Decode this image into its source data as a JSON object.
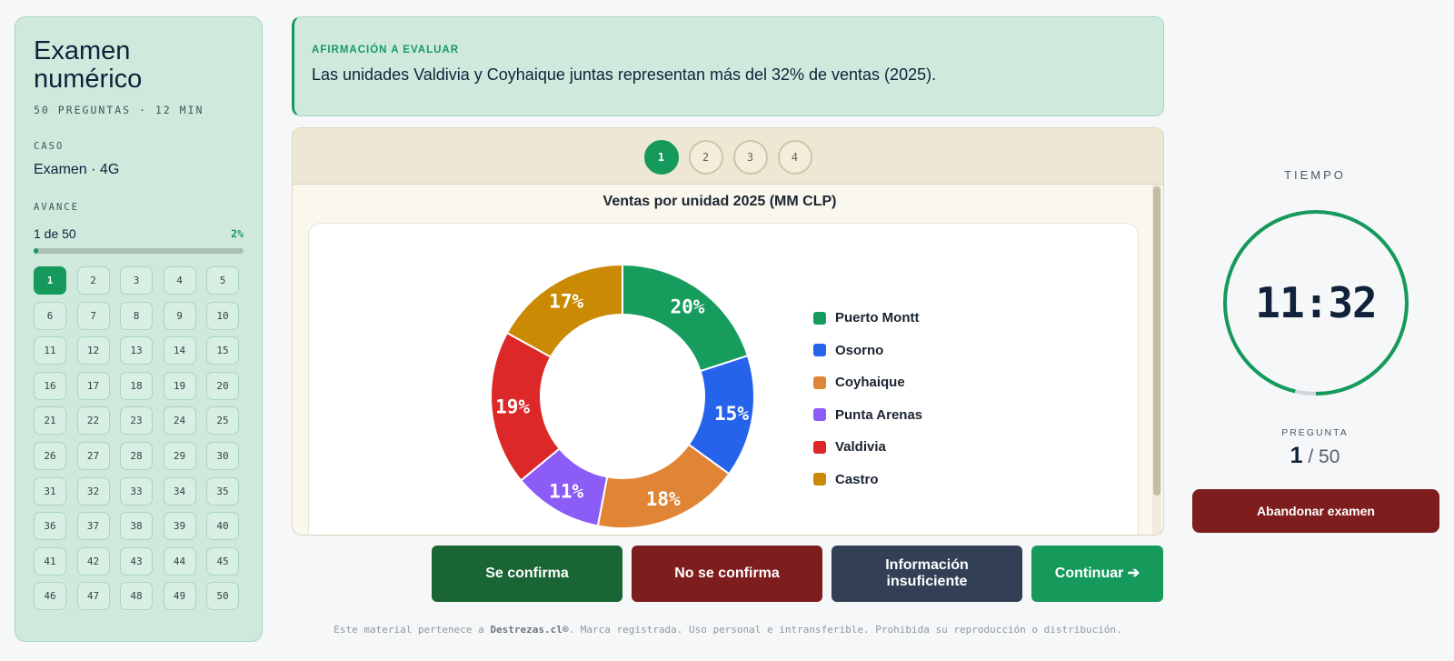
{
  "sidebar": {
    "title_line1": "Examen",
    "title_line2": "numérico",
    "meta": "50 PREGUNTAS · 12 MIN",
    "caso_label": "CASO",
    "caso_value": "Examen · 4G",
    "avance_label": "AVANCE",
    "progress_text": "1 de 50",
    "progress_pct_label": "2%",
    "progress_fraction": 0.02,
    "current_question": 1,
    "question_count": 50
  },
  "statement": {
    "label": "AFIRMACIÓN A EVALUAR",
    "text": "Las unidades Valdivia y Coyhaique juntas representan más del 32% de ventas (2025)."
  },
  "panel": {
    "tabs": [
      "1",
      "2",
      "3",
      "4"
    ],
    "active_tab": 0
  },
  "chart_data": {
    "type": "pie",
    "title": "Ventas por unidad 2025 (MM CLP)",
    "donut": true,
    "legend_position": "right",
    "categories": [
      "Puerto Montt",
      "Osorno",
      "Coyhaique",
      "Punta Arenas",
      "Valdivia",
      "Castro"
    ],
    "values": [
      20,
      15,
      18,
      11,
      19,
      17
    ],
    "labels": [
      "20%",
      "15%",
      "18%",
      "11%",
      "19%",
      "17%"
    ],
    "colors": [
      "#169c5c",
      "#2563eb",
      "#e08535",
      "#8b5cf6",
      "#dc2828",
      "#ca8a04"
    ]
  },
  "actions": {
    "confirm": "Se confirma",
    "not_confirm": "No se confirma",
    "insufficient_line1": "Información",
    "insufficient_line2": "insuficiente",
    "continue": "Continuar ➔"
  },
  "footer": {
    "prefix": "Este material pertenece a ",
    "brand": "Destrezas.cl®",
    "suffix": ". Marca registrada. Uso personal e intransferible. Prohibida su reproducción o distribución."
  },
  "timer": {
    "label": "TIEMPO",
    "minutes": "11",
    "separator": ":",
    "seconds": "32",
    "remaining_fraction": 0.963,
    "color": "#159a5c",
    "track_color": "#cfd5d8"
  },
  "question": {
    "label": "PREGUNTA",
    "current": "1",
    "total": " / 50"
  },
  "abandon_label": "Abandonar examen",
  "colors": {
    "accent": "#159a5c",
    "danger": "#7e1d1d",
    "sidebar_bg": "#cfeadd"
  }
}
